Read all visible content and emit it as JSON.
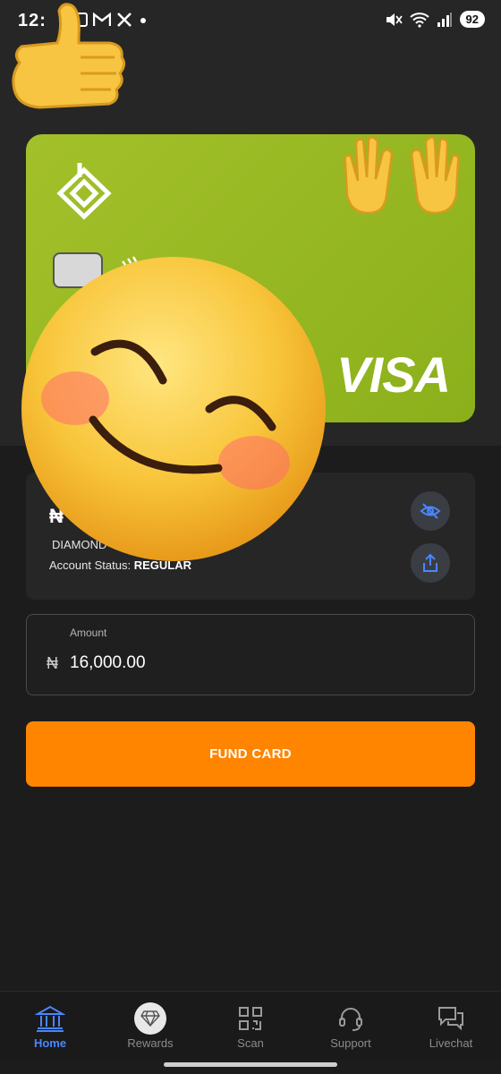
{
  "status_bar": {
    "time": "12:",
    "battery": "92"
  },
  "card": {
    "brand": "VISA"
  },
  "account": {
    "balance": "₦",
    "tier": "DIAMOND",
    "status_label": "Account Status:",
    "status_value": "REGULAR"
  },
  "amount_field": {
    "label": "Amount",
    "currency": "₦",
    "value": "16,000.00"
  },
  "fund_button": {
    "label": "FUND CARD"
  },
  "nav": {
    "items": [
      {
        "label": "Home",
        "icon": "bank-icon",
        "active": true
      },
      {
        "label": "Rewards",
        "icon": "diamond-icon",
        "active": false
      },
      {
        "label": "Scan",
        "icon": "qr-code-icon",
        "active": false
      },
      {
        "label": "Support",
        "icon": "headset-icon",
        "active": false
      },
      {
        "label": "Livechat",
        "icon": "chat-bubbles-icon",
        "active": false
      }
    ]
  },
  "colors": {
    "accent": "#ff8400",
    "active_nav": "#4a86ff",
    "card": "#9bbb22",
    "background": "#1c1c1d"
  }
}
